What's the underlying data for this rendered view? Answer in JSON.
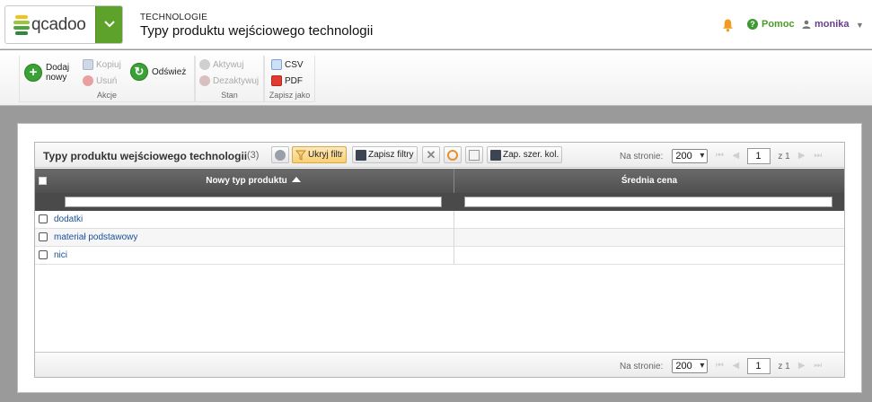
{
  "header": {
    "logo_text": "qcadoo",
    "section": "TECHNOLOGIE",
    "title": "Typy produktu wejściowego technologii",
    "help_label": "Pomoc",
    "user_label": "monika",
    "icons": {
      "bell": "bell-icon",
      "help": "help-icon",
      "user": "user-icon",
      "menu": "chevron-down-icon"
    }
  },
  "ribbon": {
    "groups": [
      {
        "label": "Akcje",
        "items": [
          "Dodaj nowy",
          "Kopiuj",
          "Usuń",
          "Odśwież"
        ]
      },
      {
        "label": "Stan",
        "items": [
          "Aktywuj",
          "Dezaktywuj"
        ]
      },
      {
        "label": "Zapisz jako",
        "items": [
          "CSV",
          "PDF"
        ]
      }
    ],
    "add_label_1": "Dodaj",
    "add_label_2": "nowy",
    "copy_label": "Kopiuj",
    "delete_label": "Usuń",
    "refresh_label": "Odśwież",
    "activate_label": "Aktywuj",
    "deactivate_label": "Dezaktywuj",
    "csv_label": "CSV",
    "pdf_label": "PDF",
    "group_actions": "Akcje",
    "group_state": "Stan",
    "group_save_as": "Zapisz jako"
  },
  "grid": {
    "title": "Typy produktu wejściowego technologii",
    "count": "(3)",
    "toolbar": {
      "hide_filter": "Ukryj filtr",
      "save_filters": "Zapisz filtry",
      "save_col_width": "Zap. szer. kol."
    },
    "pager": {
      "per_page_label": "Na stronie:",
      "per_page_value": "200",
      "page_value": "1",
      "of_label": "z 1"
    },
    "columns": [
      "Nowy typ produktu",
      "Średnia cena"
    ],
    "rows": [
      {
        "name": "dodatki",
        "price": ""
      },
      {
        "name": "materiał podstawowy",
        "price": ""
      },
      {
        "name": "nici",
        "price": ""
      }
    ]
  },
  "colors": {
    "brand_green": "#5da32b",
    "link_blue": "#1a4f9c",
    "header_dark": "#555555",
    "user_purple": "#6b3e8c"
  }
}
